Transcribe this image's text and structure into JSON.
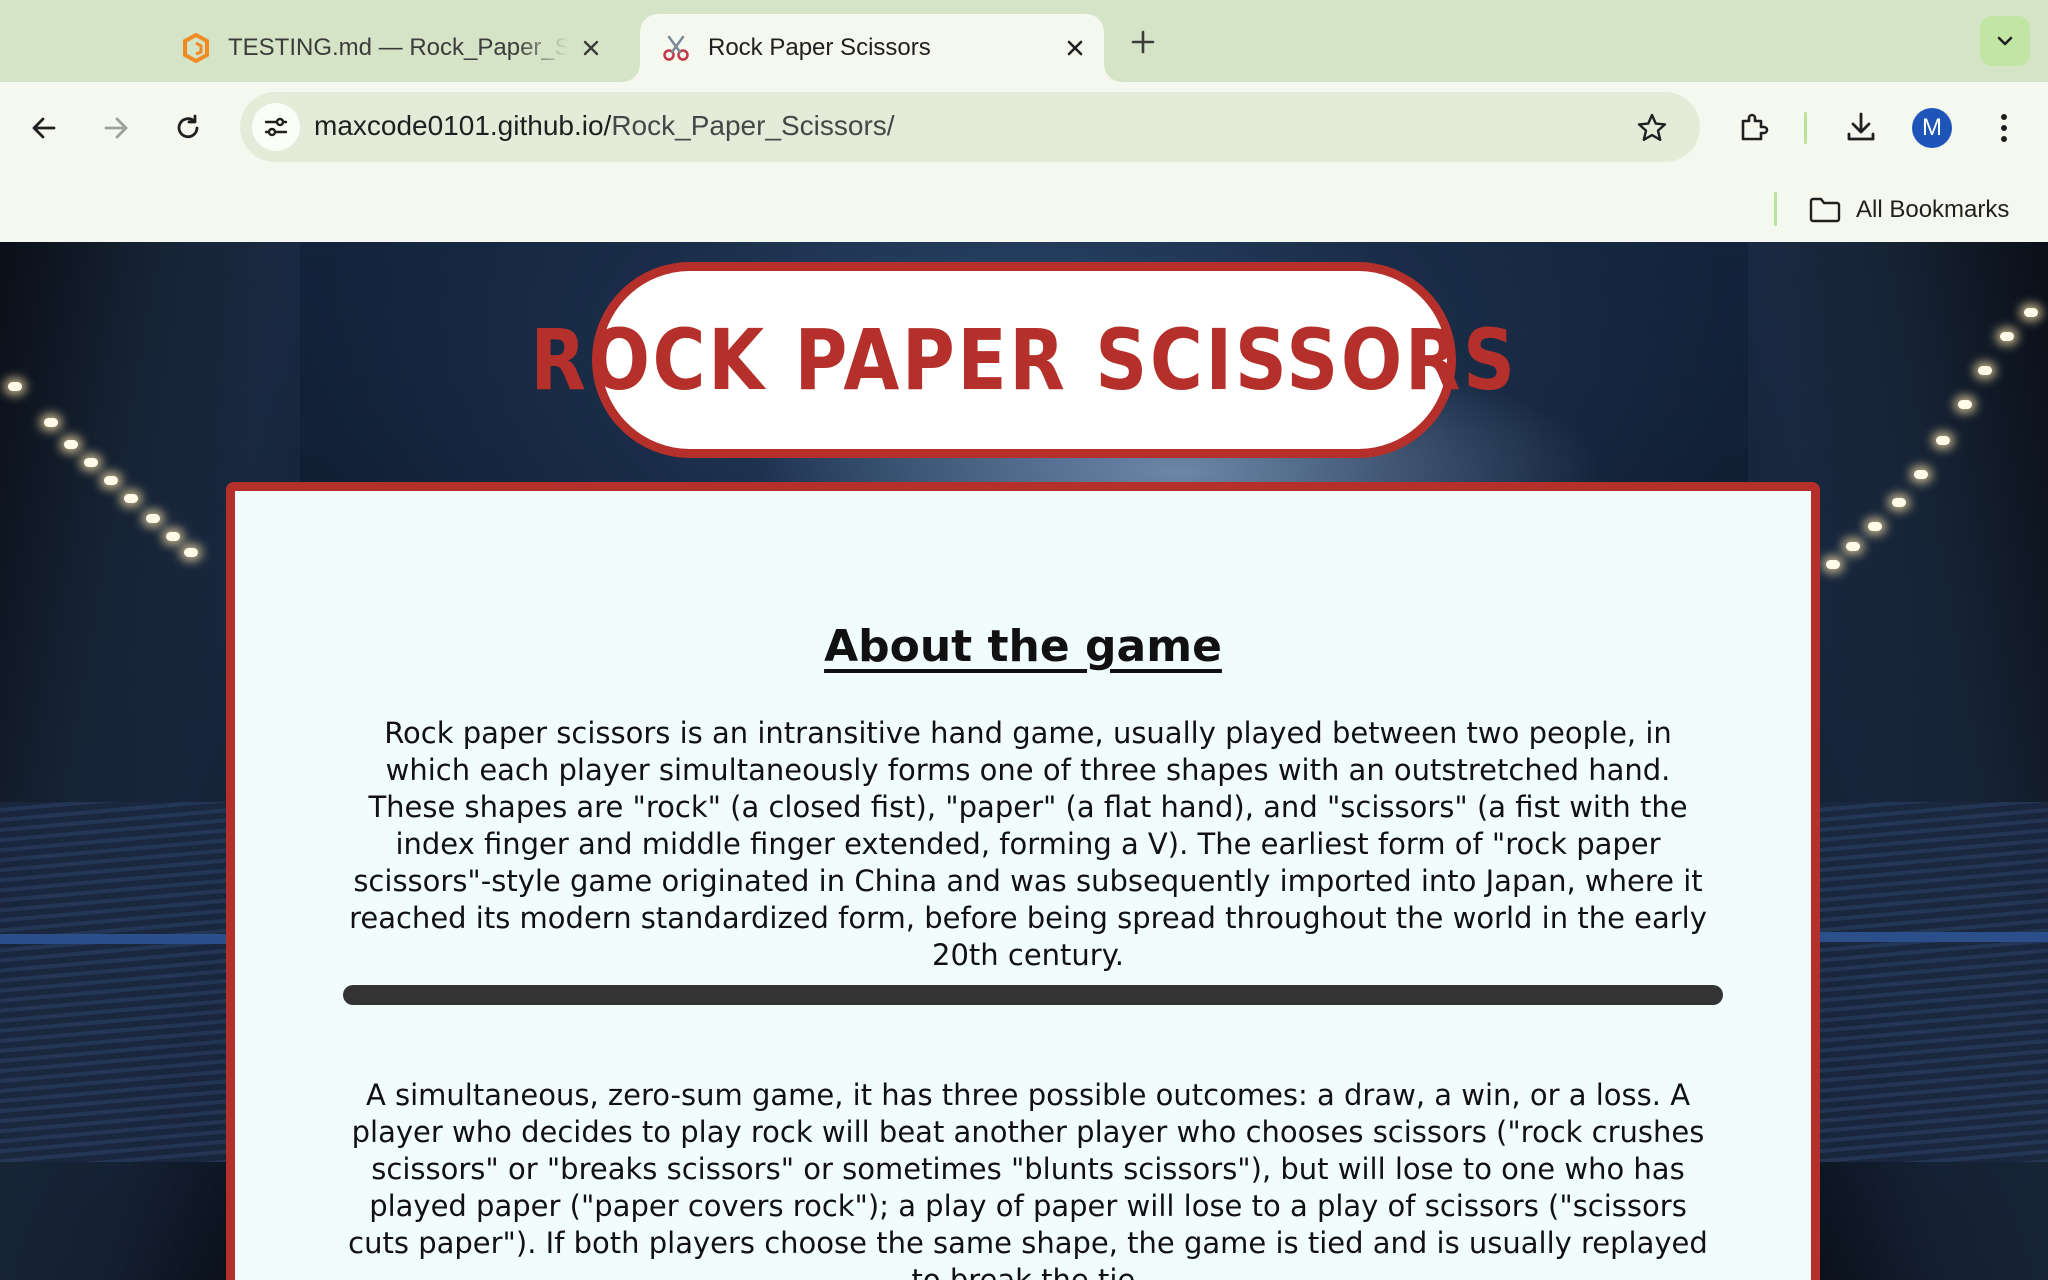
{
  "browser": {
    "tabs": [
      {
        "title": "TESTING.md — Rock_Paper_Scissors",
        "icon": "editor-logo-icon",
        "active": false
      },
      {
        "title": "Rock Paper Scissors",
        "icon": "scissors-icon",
        "active": true
      }
    ],
    "url": {
      "host": "maxcode0101.github.io/",
      "path": "Rock_Paper_Scissors/"
    },
    "profile_initial": "M",
    "bookmarks_label": "All Bookmarks",
    "accent_color": "#c1e6a4"
  },
  "page": {
    "title": "ROCK PAPER SCISSORS",
    "about_heading": "About the game",
    "paragraph_1": "Rock paper scissors is an intransitive hand game, usually played between two people, in which each player simultaneously forms one of three shapes with an outstretched hand. These shapes are \"rock\" (a closed fist), \"paper\" (a flat hand), and \"scissors\" (a fist with the index finger and middle finger extended, forming a V). The earliest form of \"rock paper scissors\"-style game originated in China and was subsequently imported into Japan, where it reached its modern standardized form, before being spread throughout the world in the early 20th century.",
    "paragraph_2": "A simultaneous, zero-sum game, it has three possible outcomes: a draw, a win, or a loss. A player who decides to play rock will beat another player who chooses scissors (\"rock crushes scissors\" or \"breaks scissors\" or sometimes \"blunts scissors\"), but will lose to one who has played paper (\"paper covers rock\"); a play of paper will lose to a play of scissors (\"scissors cuts paper\"). If both players choose the same shape, the game is tied and is usually replayed to break the tie.",
    "theme_color": "#b5302b",
    "panel_color": "#f1fdfd"
  }
}
